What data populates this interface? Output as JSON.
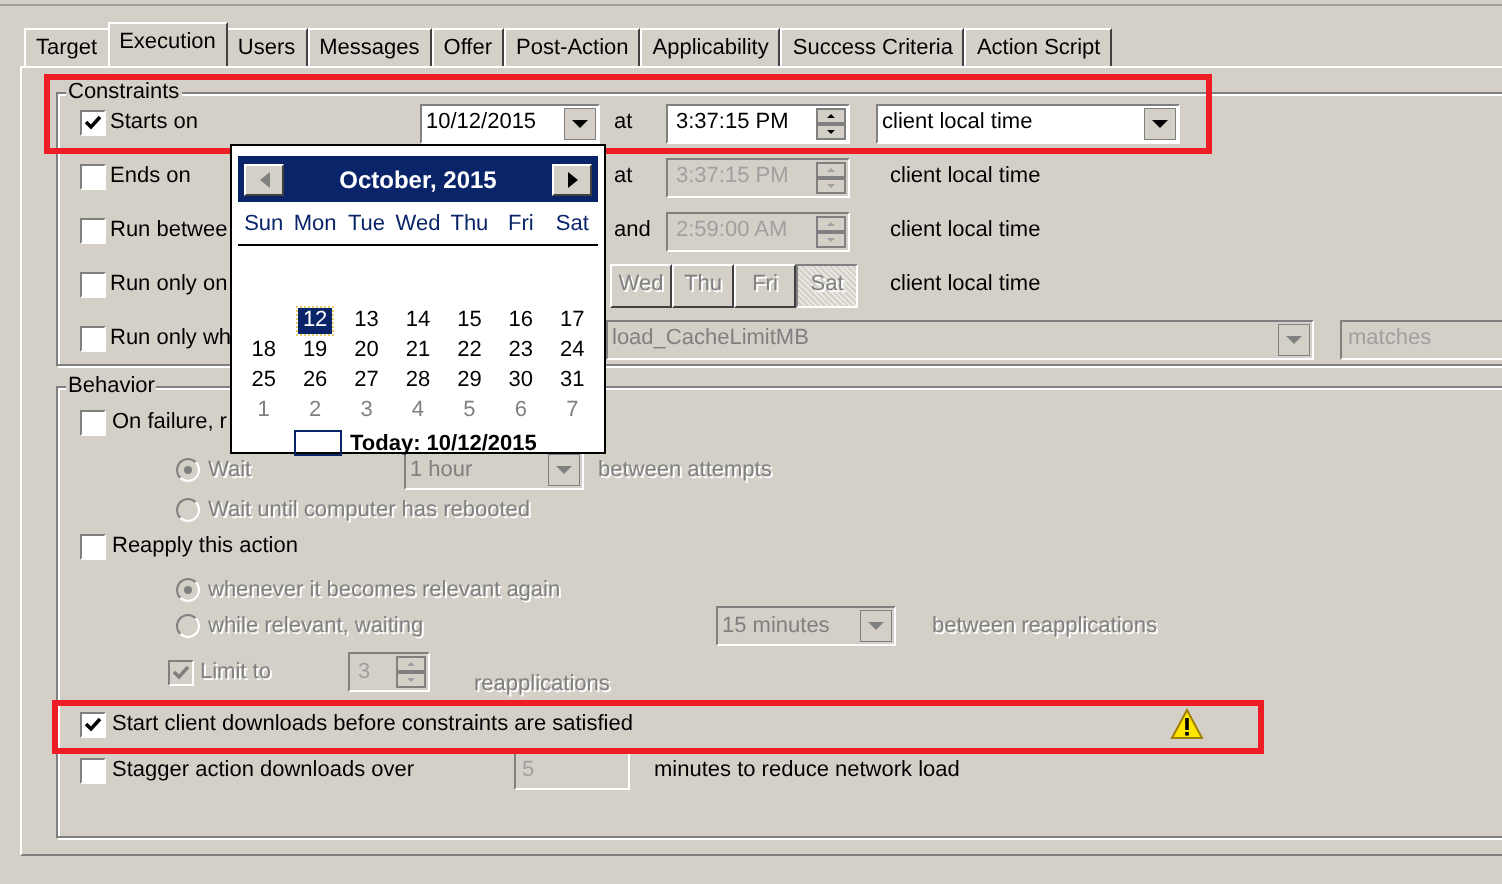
{
  "tabs": [
    {
      "label": "Target",
      "selected": false
    },
    {
      "label": "Execution",
      "selected": true
    },
    {
      "label": "Users",
      "selected": false
    },
    {
      "label": "Messages",
      "selected": false
    },
    {
      "label": "Offer",
      "selected": false
    },
    {
      "label": "Post-Action",
      "selected": false
    },
    {
      "label": "Applicability",
      "selected": false
    },
    {
      "label": "Success Criteria",
      "selected": false
    },
    {
      "label": "Action Script",
      "selected": false
    }
  ],
  "constraints": {
    "title": "Constraints",
    "rows": [
      {
        "kind": "date",
        "label": "Starts on",
        "checked": true,
        "date": "10/12/2015",
        "joiner": "at",
        "time": {
          "value": "3:37:15 PM",
          "disabled": false
        },
        "timezone": "client local time"
      },
      {
        "kind": "time",
        "label": "Ends on",
        "checked": false,
        "joiner": "at",
        "time": {
          "value": "3:37:15 PM",
          "disabled": true
        },
        "timezone": "client local time"
      },
      {
        "kind": "time",
        "label": "Run betwee",
        "checked": false,
        "joiner": "and",
        "time": {
          "value": "2:59:00 AM",
          "disabled": true
        },
        "timezone": "client local time"
      },
      {
        "kind": "days",
        "label": "Run only on",
        "checked": false,
        "days": [
          {
            "label": "Wed",
            "selected": false
          },
          {
            "label": "Thu",
            "selected": false
          },
          {
            "label": "Fri",
            "selected": false
          },
          {
            "label": "Sat",
            "selected": true
          }
        ],
        "timezone": "client local time"
      },
      {
        "kind": "property",
        "label": "Run only wh",
        "checked": false,
        "property": "load_CacheLimitMB",
        "operator": "matches"
      }
    ]
  },
  "behavior": {
    "title": "Behavior",
    "items": [
      {
        "kind": "checkbox",
        "label": "On failure, r",
        "checked": false,
        "disabled": false
      },
      {
        "kind": "radio",
        "label": "Wait",
        "selected": true,
        "disabled": true,
        "select": "1 hour",
        "suffix": "between attempts"
      },
      {
        "kind": "radio",
        "label": "Wait until computer has rebooted",
        "selected": false,
        "disabled": true
      },
      {
        "kind": "checkbox",
        "label": "Reapply this action",
        "checked": false,
        "disabled": false
      },
      {
        "kind": "radio",
        "label": "whenever it becomes relevant again",
        "selected": true,
        "disabled": true
      },
      {
        "kind": "radio",
        "label": "while relevant, waiting",
        "selected": false,
        "disabled": true,
        "select": "15 minutes",
        "suffix": "between reapplications"
      },
      {
        "kind": "limit",
        "label": "Limit to",
        "checked": true,
        "disabled": true,
        "value": "3",
        "suffix": "reapplications"
      },
      {
        "kind": "checkbox",
        "label": "Start client downloads before constraints are satisfied",
        "checked": true,
        "disabled": false,
        "warning": true
      },
      {
        "kind": "stagger",
        "label": "Stagger action downloads over",
        "checked": false,
        "disabled": false,
        "value": "5",
        "suffix": "minutes to reduce network load"
      }
    ]
  },
  "calendar": {
    "month": "October, 2015",
    "weekdays": [
      "Sun",
      "Mon",
      "Tue",
      "Wed",
      "Thu",
      "Fri",
      "Sat"
    ],
    "weeks": [
      [
        {
          "day": "12",
          "selected": true,
          "other_month": false
        },
        {
          "day": "13",
          "selected": false,
          "other_month": false
        },
        {
          "day": "14",
          "selected": false,
          "other_month": false
        },
        {
          "day": "15",
          "selected": false,
          "other_month": false
        },
        {
          "day": "16",
          "selected": false,
          "other_month": false
        },
        {
          "day": "17",
          "selected": false,
          "other_month": false
        }
      ],
      [
        {
          "day": "18",
          "selected": false,
          "other_month": false
        },
        {
          "day": "19",
          "selected": false,
          "other_month": false
        },
        {
          "day": "20",
          "selected": false,
          "other_month": false
        },
        {
          "day": "21",
          "selected": false,
          "other_month": false
        },
        {
          "day": "22",
          "selected": false,
          "other_month": false
        },
        {
          "day": "23",
          "selected": false,
          "other_month": false
        },
        {
          "day": "24",
          "selected": false,
          "other_month": false
        }
      ],
      [
        {
          "day": "25",
          "selected": false,
          "other_month": false
        },
        {
          "day": "26",
          "selected": false,
          "other_month": false
        },
        {
          "day": "27",
          "selected": false,
          "other_month": false
        },
        {
          "day": "28",
          "selected": false,
          "other_month": false
        },
        {
          "day": "29",
          "selected": false,
          "other_month": false
        },
        {
          "day": "30",
          "selected": false,
          "other_month": false
        },
        {
          "day": "31",
          "selected": false,
          "other_month": false
        }
      ],
      [
        {
          "day": "1",
          "selected": false,
          "other_month": true
        },
        {
          "day": "2",
          "selected": false,
          "other_month": true
        },
        {
          "day": "3",
          "selected": false,
          "other_month": true
        },
        {
          "day": "4",
          "selected": false,
          "other_month": true
        },
        {
          "day": "5",
          "selected": false,
          "other_month": true
        },
        {
          "day": "6",
          "selected": false,
          "other_month": true
        },
        {
          "day": "7",
          "selected": false,
          "other_month": true
        }
      ]
    ],
    "today": "Today: 10/12/2015"
  }
}
